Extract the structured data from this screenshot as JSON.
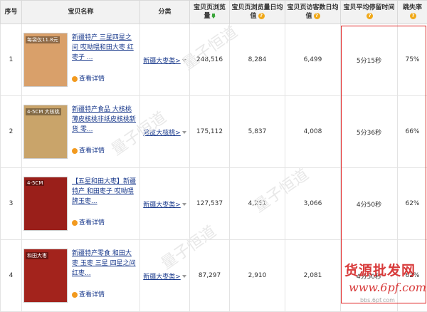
{
  "headers": {
    "index": "序号",
    "item_name": "宝贝名称",
    "category": "分类",
    "pv_total": "宝贝页浏览量",
    "pv_daily": "宝贝页浏览量日均值",
    "uv_daily": "宝贝页访客数日均值",
    "avg_stay": "宝贝平均停留时间",
    "bounce": "跳失率"
  },
  "detail_label": "查看详情",
  "rows": [
    {
      "index": "1",
      "title": "新疆特产 三星四星之间 哎呦喂和田大枣 红枣子 ...",
      "category": "新疆大枣类>",
      "pv_total": "248,516",
      "pv_daily": "8,284",
      "uv_daily": "6,499",
      "avg_stay": "5分15秒",
      "bounce": "75%",
      "thumb_text": "每袋仅11.8元",
      "thumb_color": "#d9a06a"
    },
    {
      "index": "2",
      "title": "新疆特产食品 大核桃 薄皮核桃非纸皮核桃新货 零...",
      "category": "薄皮大核桃>",
      "pv_total": "175,112",
      "pv_daily": "5,837",
      "uv_daily": "4,008",
      "avg_stay": "5分36秒",
      "bounce": "66%",
      "thumb_text": "4-5CM 大核桃",
      "thumb_color": "#c9a46a"
    },
    {
      "index": "3",
      "title": "【五星和田大枣】新疆特产 和田枣子 哎呦喂牌玉枣...",
      "category": "新疆大枣类>",
      "pv_total": "127,537",
      "pv_daily": "4,251",
      "uv_daily": "3,066",
      "avg_stay": "4分50秒",
      "bounce": "62%",
      "thumb_text": "4-5CM",
      "thumb_color": "#9a1f1a"
    },
    {
      "index": "4",
      "title": "新疆特产零食 和田大枣 玉枣 三星 四星之间 红枣...",
      "category": "新疆大枣类>",
      "pv_total": "87,297",
      "pv_daily": "2,910",
      "uv_daily": "2,081",
      "avg_stay": "4分50秒",
      "bounce": "62%",
      "thumb_text": "和田大枣",
      "thumb_color": "#a3231c"
    }
  ],
  "brand": {
    "name": "货源批发网",
    "url": "www.6pf.com",
    "small": "bbs.6pf.com"
  },
  "colors": {
    "highlight_box": "#e02020",
    "link": "#1a3a8c",
    "header_bg": "#f2f2f2"
  }
}
